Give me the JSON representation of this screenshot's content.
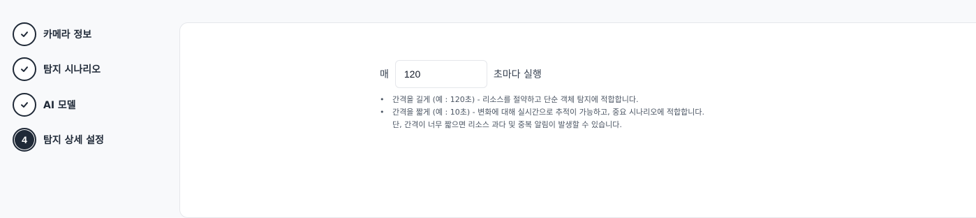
{
  "sidebar": {
    "steps": [
      {
        "label": "카메라 정보",
        "status": "completed",
        "icon": "check-icon"
      },
      {
        "label": "탐지 시나리오",
        "status": "completed",
        "icon": "check-icon"
      },
      {
        "label": "AI 모델",
        "status": "completed",
        "icon": "check-icon"
      },
      {
        "label": "탐지 상세 설정",
        "status": "active",
        "number": "4"
      }
    ]
  },
  "interval": {
    "prefix": "매",
    "value": "120",
    "suffix": "초마다 실행"
  },
  "help": {
    "items": [
      {
        "text": "간격을 길게 (예 : 120초) - 리소스를 절약하고 단순 객체 탐지에 적합합니다."
      },
      {
        "text": "간격을 짧게 (예 : 10초) - 변화에 대해 실시간으로 추적이 가능하고, 중요 시나리오에 적합합니다.",
        "continuation": "단, 간격이 너무 짧으면 리소스 과다 및 중복 알림이 발생할 수 있습니다."
      }
    ]
  },
  "colors": {
    "page_background": "#f8f9fb",
    "panel_background": "#ffffff",
    "step_dark": "#1f2937",
    "border": "#e5e7eb"
  }
}
